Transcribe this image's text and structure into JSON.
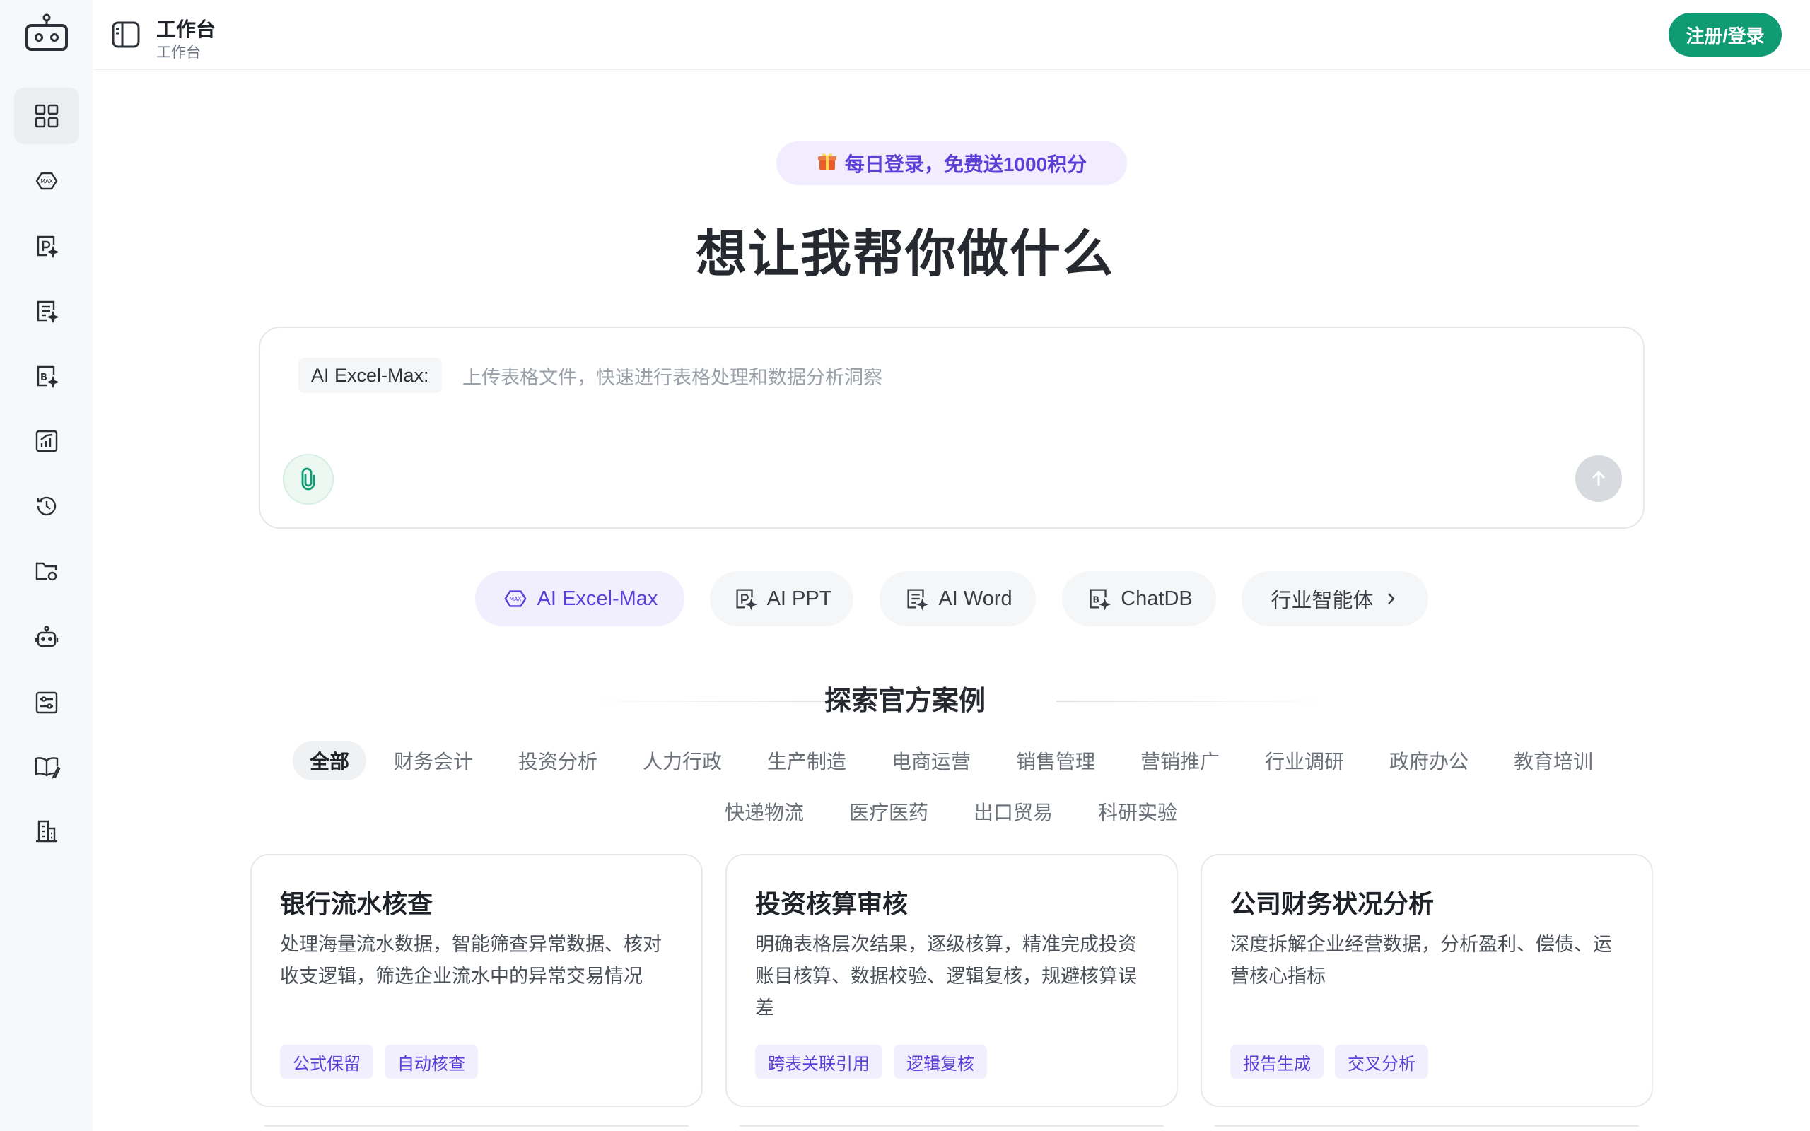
{
  "topbar": {
    "title": "工作台",
    "subtitle": "工作台",
    "login_label": "注册/登录"
  },
  "sidebar": {
    "items": [
      {
        "name": "workspace",
        "icon": "grid-icon",
        "active": true
      },
      {
        "name": "excel-max",
        "icon": "excel-max-icon"
      },
      {
        "name": "ai-ppt",
        "icon": "ppt-icon"
      },
      {
        "name": "ai-word",
        "icon": "word-icon"
      },
      {
        "name": "chatdb",
        "icon": "chatdb-icon"
      },
      {
        "name": "analysis",
        "icon": "chart-icon"
      },
      {
        "name": "history",
        "icon": "history-icon"
      },
      {
        "name": "files",
        "icon": "folder-icon"
      },
      {
        "name": "agents",
        "icon": "robot-icon"
      },
      {
        "name": "settings",
        "icon": "sliders-icon"
      },
      {
        "name": "knowledge",
        "icon": "book-icon"
      },
      {
        "name": "enterprise",
        "icon": "building-icon"
      }
    ]
  },
  "hero": {
    "promo": "每日登录，免费送1000积分",
    "headline": "想让我帮你做什么"
  },
  "input": {
    "mode_tag": "AI Excel-Max:",
    "placeholder": "上传表格文件，快速进行表格处理和数据分析洞察"
  },
  "quick_actions": [
    {
      "label": "AI Excel-Max",
      "icon": "excel-max-icon",
      "active": true
    },
    {
      "label": "AI PPT",
      "icon": "ppt-icon"
    },
    {
      "label": "AI Word",
      "icon": "word-icon"
    },
    {
      "label": "ChatDB",
      "icon": "chatdb-icon"
    },
    {
      "label": "行业智能体",
      "icon": "chevron-right-icon"
    }
  ],
  "explore": {
    "title": "探索官方案例",
    "categories": [
      "全部",
      "财务会计",
      "投资分析",
      "人力行政",
      "生产制造",
      "电商运营",
      "销售管理",
      "营销推广",
      "行业调研",
      "政府办公",
      "教育培训",
      "快递物流",
      "医疗医药",
      "出口贸易",
      "科研实验"
    ],
    "active_category": "全部"
  },
  "cards": [
    {
      "title": "银行流水核查",
      "desc": "处理海量流水数据，智能筛查异常数据、核对收支逻辑，筛选企业流水中的异常交易情况",
      "tags": [
        "公式保留",
        "自动核查"
      ]
    },
    {
      "title": "投资核算审核",
      "desc": "明确表格层次结果，逐级核算，精准完成投资账目核算、数据校验、逻辑复核，规避核算误差",
      "tags": [
        "跨表关联引用",
        "逻辑复核"
      ]
    },
    {
      "title": "公司财务状况分析",
      "desc": "深度拆解企业经营数据，分析盈利、偿债、运营核心指标",
      "tags": [
        "报告生成",
        "交叉分析"
      ]
    }
  ],
  "colors": {
    "brand_green": "#0f9b74",
    "accent_purple": "#5b3fd6"
  }
}
